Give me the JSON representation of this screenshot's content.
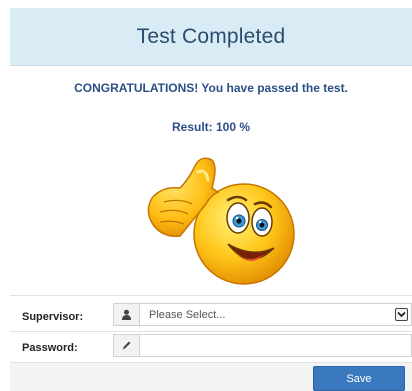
{
  "dialog": {
    "title": "Test Completed"
  },
  "message": {
    "congrats": "CONGRATULATIONS! You have passed the test.",
    "result": "Result: 100 %"
  },
  "form": {
    "supervisor_label": "Supervisor:",
    "supervisor_value": "Please Select...",
    "supervisor_icon": "user-icon",
    "password_label": "Password:",
    "password_value": "",
    "password_icon": "pencil-icon"
  },
  "actions": {
    "save_label": "Save"
  },
  "colors": {
    "header_bg": "#d9ebf5",
    "title_text": "#2a4d6e",
    "message_text": "#2b4f86",
    "primary_button": "#3b79bf"
  },
  "illustration": "thumbs-up-emoji"
}
